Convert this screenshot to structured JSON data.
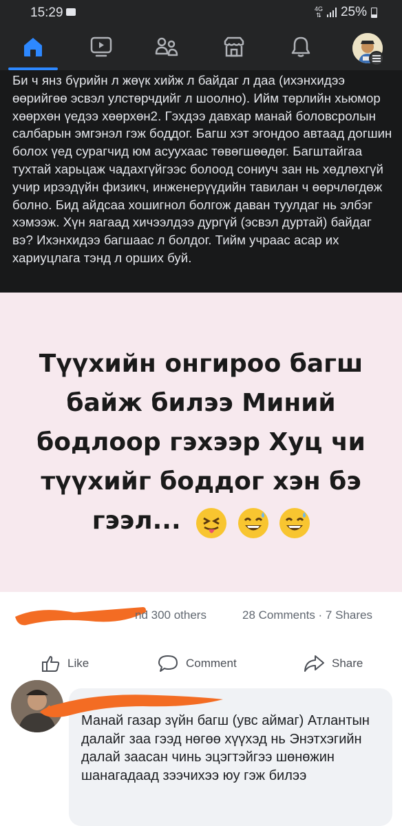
{
  "status_bar": {
    "time": "15:29",
    "network": "4G",
    "battery": "25%"
  },
  "nav": {
    "items": [
      "home",
      "watch",
      "groups",
      "marketplace",
      "notifications",
      "menu"
    ],
    "active": "home"
  },
  "post": {
    "text": "Би ч янз бүрийн л жөүк хийж л байдаг л даа (ихэнхидээ өөрийгөө эсвэл улстөрчдийг л шоолно). Ийм төрлийн хьюмор хөөрхөн үедээ хөөрхөн2. Гэхдээ давхар манай боловсролын салбарын эмгэнэл гэж боддог. Багш хэт эгондоо автаад догшин болох үед сурагчид юм асуухаас төвөгшөөдөг. Багштайгаа тухтай харьцаж чадахгүйгээс болоод сониуч зан нь хөдлөхгүй учир ирээдүйн физикч, инженерүүдийн тавилан ч өөрчлөгдөж болно. Бид айдсаа хошигнол болгож даван туулдаг нь элбэг хэмээж. Хүн яагаад хичээлдээ дургүй (эсвэл дуртай) байдаг вэ? Ихэнхидээ багшаас л болдог. Тийм учраас асар их хариуцлага тэнд л орших буй."
  },
  "meme": {
    "lines": [
      "Түүхийн онгироо багш",
      "байж билээ Миний",
      "бодлоор гэхээр Хуц чи",
      "түүхийг боддог хэн бэ",
      "гээл..."
    ],
    "emojis": [
      "squinting-tongue-emoji",
      "sweat-smile-emoji",
      "sweat-smile-emoji"
    ]
  },
  "inner_post": {
    "likes_text": "nd 300 others",
    "comments_shares": "28 Comments · 7 Shares",
    "actions": {
      "like": "Like",
      "comment": "Comment",
      "share": "Share"
    },
    "comment_text": "Манай газар зүйн багш (увс аймаг) Атлантын далайг заа гээд нөгөө хүүхэд нь Энэтхэгийн далай заасан чинь эцэгтэйгээ шөнөжин шанагадаад зээчихээ юу гэж билээ"
  },
  "colors": {
    "dark_bg": "#18191a",
    "bar_bg": "#242526",
    "accent": "#2d88ff",
    "meme_bg": "#f7e9ee",
    "scribble": "#f36c23"
  }
}
